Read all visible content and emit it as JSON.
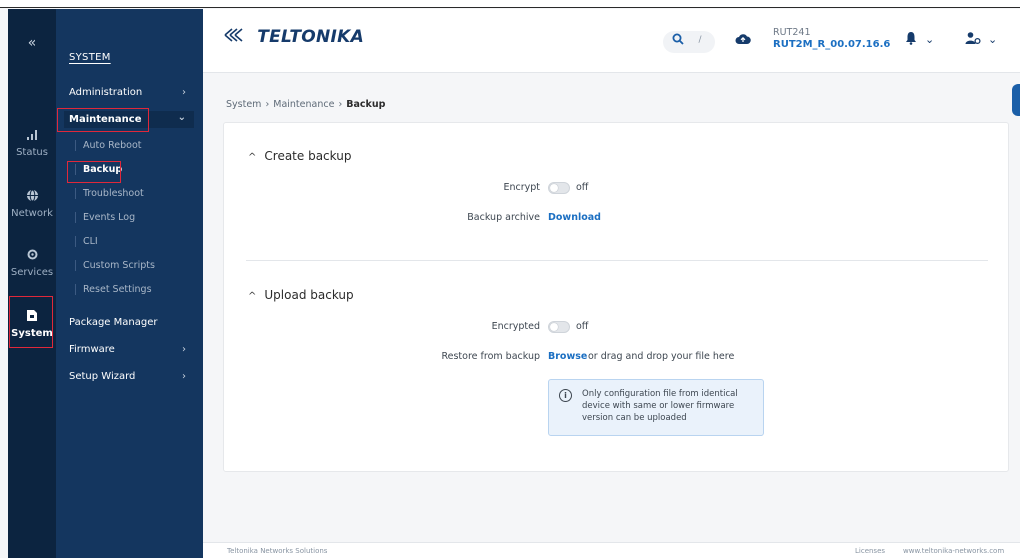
{
  "rail": {
    "collapse_icon": "«",
    "items": [
      {
        "label": "Status",
        "icon": "signal-icon"
      },
      {
        "label": "Network",
        "icon": "globe-icon"
      },
      {
        "label": "Services",
        "icon": "gear-icon"
      },
      {
        "label": "System",
        "icon": "system-icon"
      }
    ]
  },
  "menu": {
    "title": "SYSTEM",
    "items": [
      {
        "label": "Administration",
        "chevron": "›"
      },
      {
        "label": "Maintenance",
        "chevron": "⌄"
      },
      {
        "label": "Package Manager"
      },
      {
        "label": "Firmware",
        "chevron": "›"
      },
      {
        "label": "Setup Wizard",
        "chevron": "›"
      }
    ],
    "subitems": [
      "Auto Reboot",
      "Backup",
      "Troubleshoot",
      "Events Log",
      "CLI",
      "Custom Scripts",
      "Reset Settings"
    ]
  },
  "header": {
    "logo": "TELTONIKA",
    "search_key": "/",
    "device_name": "RUT241",
    "firmware": "RUT2M_R_00.07.16.6"
  },
  "breadcrumb": {
    "items": [
      "System",
      "Maintenance",
      "Backup"
    ],
    "separator": "›"
  },
  "create_backup": {
    "title": "Create backup",
    "encrypt_label": "Encrypt",
    "encrypt_value": "off",
    "archive_label": "Backup archive",
    "archive_link": "Download"
  },
  "upload_backup": {
    "title": "Upload backup",
    "encrypted_label": "Encrypted",
    "encrypted_value": "off",
    "restore_label": "Restore from backup",
    "browse_link": "Browse",
    "restore_hint": "or drag and drop your file here",
    "info_text": "Only configuration file from identical device with same or lower firmware version can be uploaded"
  },
  "footer": {
    "left": "Teltonika Networks Solutions",
    "licenses": "Licenses",
    "website": "www.teltonika-networks.com"
  },
  "colors": {
    "rail_bg": "#0c2440",
    "menu_bg": "#14365f",
    "accent": "#1b6fc2",
    "highlight_box": "#e0283a"
  }
}
